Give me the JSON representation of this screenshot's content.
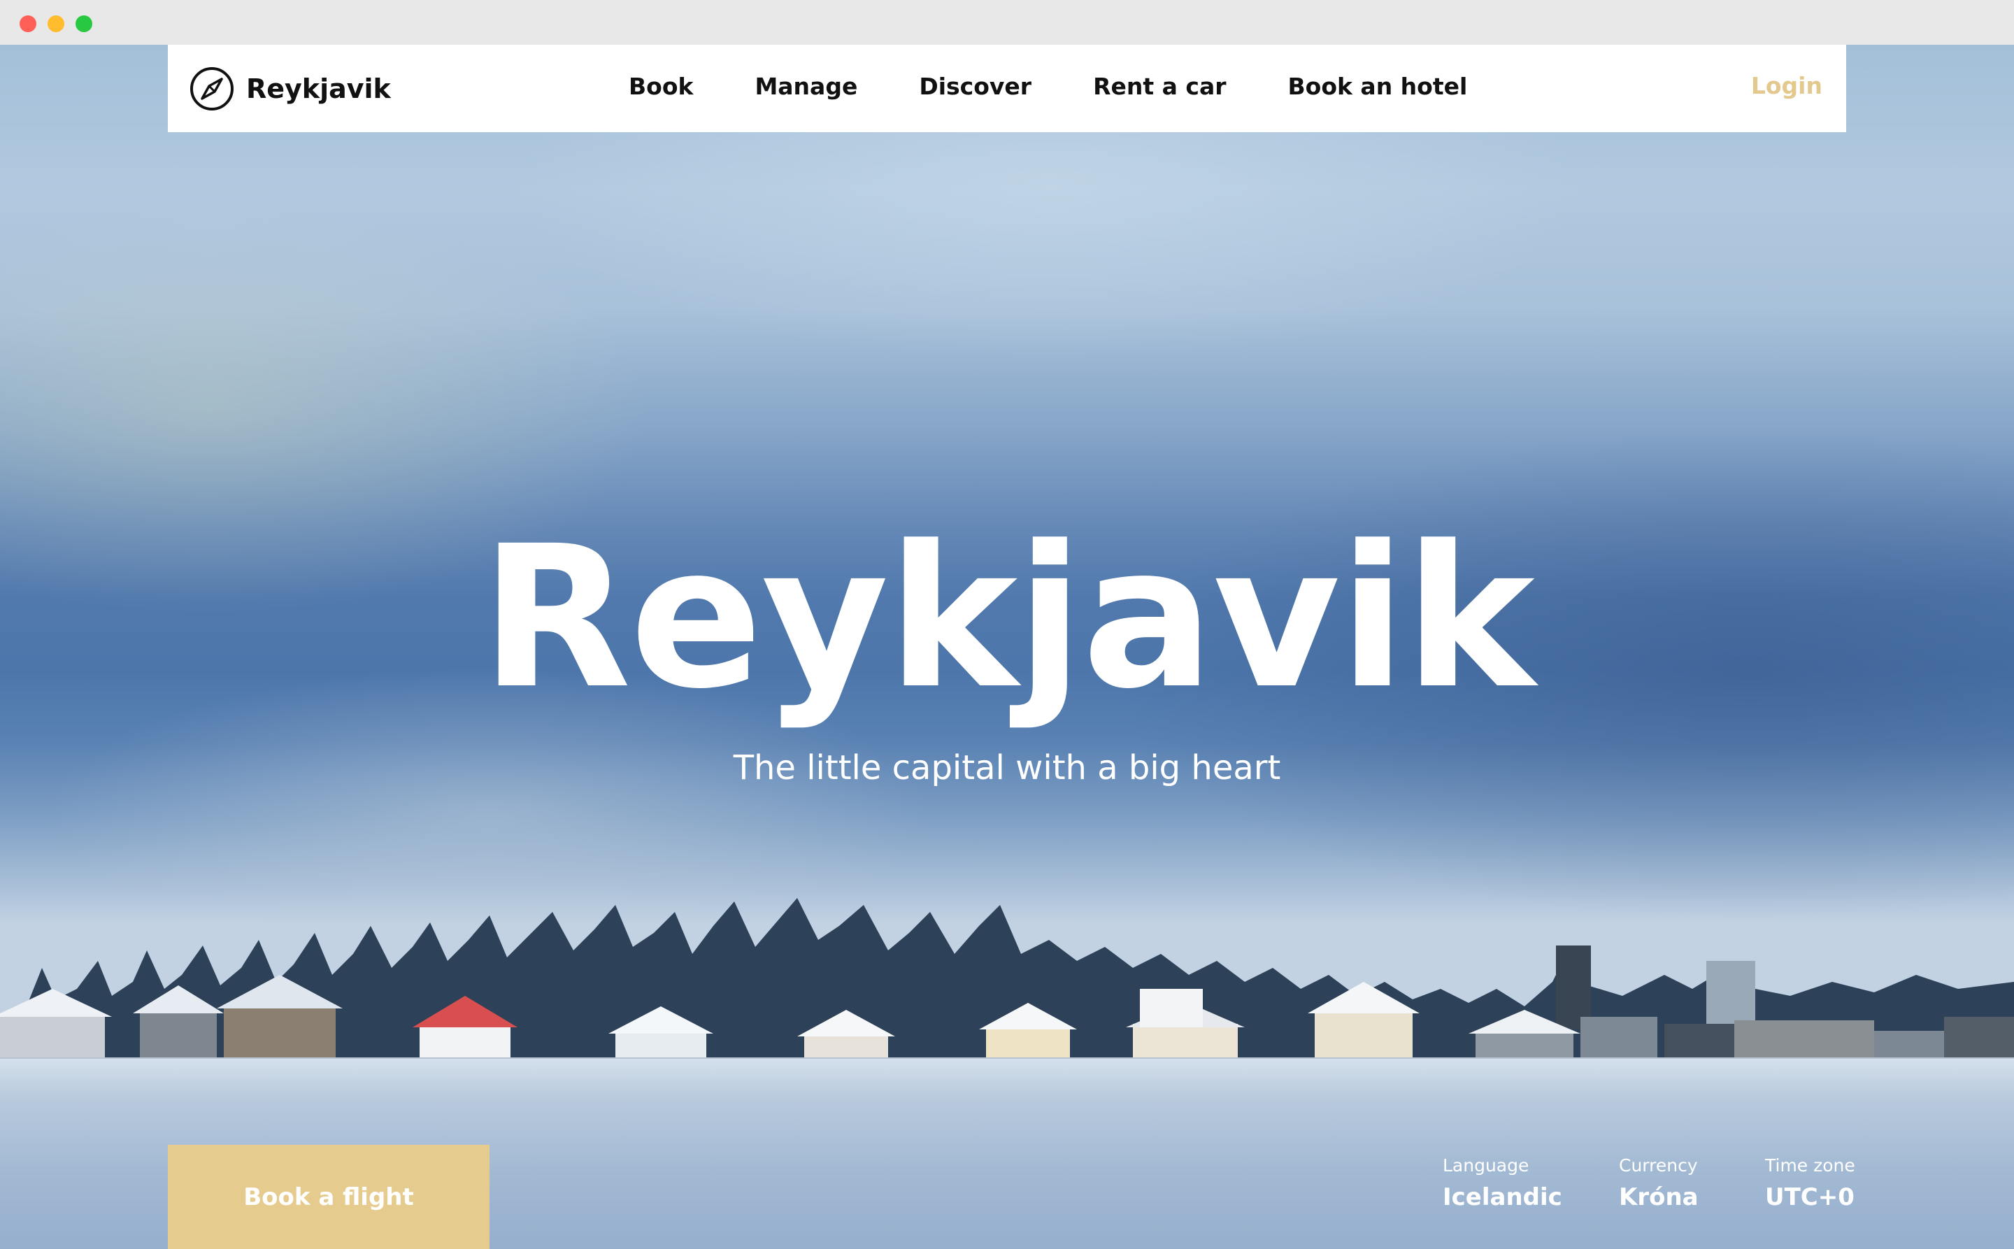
{
  "brand": {
    "name": "Reykjavik",
    "icon": "compass-icon"
  },
  "nav": {
    "links": [
      {
        "label": "Book"
      },
      {
        "label": "Manage"
      },
      {
        "label": "Discover"
      },
      {
        "label": "Rent a car"
      },
      {
        "label": "Book an hotel"
      }
    ],
    "login_label": "Login"
  },
  "hero": {
    "title": "Reykjavik",
    "subtitle": "The little capital with a big heart",
    "cta_label": "Book a flight"
  },
  "facts": {
    "language": {
      "label": "Language",
      "value": "Icelandic"
    },
    "currency": {
      "label": "Currency",
      "value": "Króna"
    },
    "timezone": {
      "label": "Time zone",
      "value": "UTC+0"
    }
  },
  "colors": {
    "accent": "#e5cc8e",
    "login": "#e3c98e",
    "navbar_bg": "#ffffff",
    "text_dark": "#111111"
  }
}
